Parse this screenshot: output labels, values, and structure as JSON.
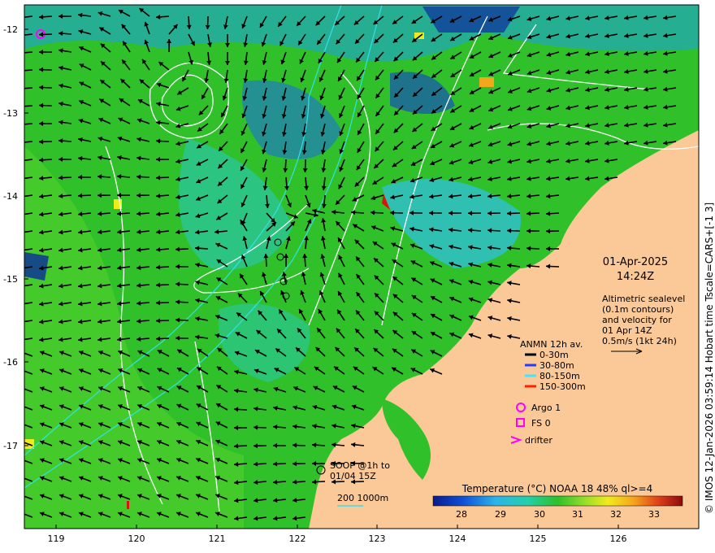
{
  "map": {
    "date": "01-Apr-2025",
    "time": "14:24Z",
    "x_ticks": [
      "119",
      "120",
      "121",
      "122",
      "123",
      "124",
      "125",
      "126"
    ],
    "y_ticks": [
      "-12",
      "-13",
      "-14",
      "-15",
      "-16",
      "-17"
    ],
    "side_caption": "© IMOS 12-Jan-2026 03:59:14 Hobart time Tscale=CARS+[-1 3]",
    "colors": {
      "land": "#fbc897",
      "sea_green": "#2fc02a",
      "contour": "#ffffff",
      "isobath": "#33e0e8",
      "arrow": "#000000"
    }
  },
  "info": {
    "line1": "Altimetric sealevel",
    "line2": "(0.1m contours)",
    "line3": "and velocity for",
    "line4": "01 Apr 14Z",
    "line5": "0.5m/s (1kt 24h)"
  },
  "legend": {
    "title": "ANMN 12h av.",
    "items": [
      {
        "label": "0-30m",
        "color": "#000000"
      },
      {
        "label": "30-80m",
        "color": "#1f3cff"
      },
      {
        "label": "80-150m",
        "color": "#3fe8ff"
      },
      {
        "label": "150-300m",
        "color": "#ff2000"
      }
    ],
    "argo": "Argo 1",
    "fs": "FS 0",
    "drifter": "drifter",
    "soop_line1": "SOOP @1h to",
    "soop_line2": "01/04 15Z",
    "isobaths": "200  1000m"
  },
  "colorbar": {
    "title": "Temperature (°C) NOAA 18 48% ql>=4",
    "ticks": [
      "28",
      "29",
      "30",
      "31",
      "32",
      "33"
    ]
  }
}
